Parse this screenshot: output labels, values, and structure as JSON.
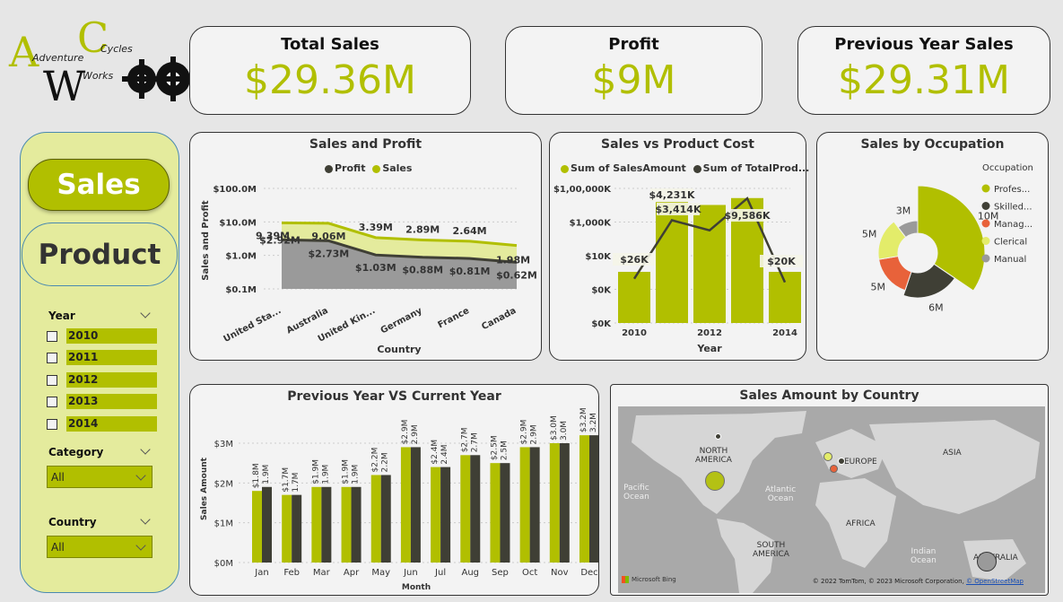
{
  "logo": {
    "line1": "Adventure",
    "line2": "Cycles",
    "line3": "Works"
  },
  "kpis": [
    {
      "title": "Total Sales",
      "value": "$29.36M"
    },
    {
      "title": "Profit",
      "value": "$9M"
    },
    {
      "title": "Previous Year Sales",
      "value": "$29.31M"
    }
  ],
  "nav": {
    "sales": "Sales",
    "product": "Product"
  },
  "filters": {
    "year_label": "Year",
    "years": [
      "2010",
      "2011",
      "2012",
      "2013",
      "2014"
    ],
    "category_label": "Category",
    "category_value": "All",
    "country_label": "Country",
    "country_value": "All"
  },
  "colors": {
    "accent": "#b1bf00",
    "dark": "#3f3f35",
    "orange": "#e8623a",
    "light": "#e3ec6a",
    "grey": "#9a9a9a"
  },
  "chart_data": [
    {
      "id": "sales_profit",
      "type": "area",
      "title": "Sales and Profit",
      "legend": [
        "Profit",
        "Sales"
      ],
      "categories": [
        "United Sta...",
        "Australia",
        "United Kin...",
        "Germany",
        "France",
        "Canada"
      ],
      "series": [
        {
          "name": "Sales",
          "values": [
            9.39,
            9.06,
            3.39,
            2.89,
            2.64,
            1.98
          ],
          "labels": [
            "9.39M",
            "9.06M",
            "3.39M",
            "2.89M",
            "2.64M",
            "1.98M"
          ]
        },
        {
          "name": "Profit",
          "values": [
            2.92,
            2.73,
            1.03,
            0.88,
            0.81,
            0.62
          ],
          "labels": [
            "$2.92M",
            "$2.73M",
            "$1.03M",
            "$0.88M",
            "$0.81M",
            "$0.62M"
          ]
        }
      ],
      "yticks": [
        "$100.0M",
        "$10.0M",
        "$1.0M",
        "$0.1M"
      ],
      "xlabel": "Country",
      "ylabel": "Sales and Profit",
      "yscale": "log"
    },
    {
      "id": "sales_cost",
      "type": "bar",
      "title": "Sales vs Product Cost",
      "legend": [
        "Sum of SalesAmount",
        "Sum of TotalProd..."
      ],
      "categories": [
        "2010",
        "2011",
        "2012",
        "2013",
        "2014"
      ],
      "xticks": [
        "2010",
        "2012",
        "2014"
      ],
      "series": [
        {
          "name": "Sum of SalesAmount",
          "values": [
            43,
            7300,
            5900,
            9800,
            43
          ]
        },
        {
          "name": "Sum of TotalProd...",
          "values": [
            26,
            4231,
            3414,
            9586,
            20
          ]
        }
      ],
      "labels": [
        "$26K",
        "$4,231K",
        "$3,414K",
        "$9,586K",
        "$20K"
      ],
      "yticks": [
        "$1,00,000K",
        "$1,000K",
        "$10K",
        "$0K",
        "$0K"
      ],
      "xlabel": "Year"
    },
    {
      "id": "occupation",
      "type": "pie",
      "title": "Sales by Occupation",
      "legend_title": "Occupation",
      "categories": [
        "Profes...",
        "Skilled...",
        "Manag...",
        "Clerical",
        "Manual"
      ],
      "values": [
        10,
        6,
        5,
        5,
        3
      ],
      "labels": [
        "10M",
        "6M",
        "5M",
        "5M",
        "3M"
      ]
    },
    {
      "id": "prev_vs_curr",
      "type": "bar",
      "title": "Previous Year VS Current Year",
      "categories": [
        "Jan",
        "Feb",
        "Mar",
        "Apr",
        "May",
        "Jun",
        "Jul",
        "Aug",
        "Sep",
        "Oct",
        "Nov",
        "Dec"
      ],
      "series": [
        {
          "name": "Previous Year",
          "values": [
            1.8,
            1.7,
            1.9,
            1.9,
            2.2,
            2.9,
            2.4,
            2.7,
            2.5,
            2.9,
            3.0,
            3.2
          ],
          "labels": [
            "$1.8M",
            "$1.7M",
            "$1.9M",
            "$1.9M",
            "$2.2M",
            "$2.9M",
            "$2.4M",
            "$2.7M",
            "$2.5M",
            "$2.9M",
            "$3.0M",
            "$3.2M"
          ]
        },
        {
          "name": "Current Year",
          "values": [
            1.9,
            1.7,
            1.9,
            1.9,
            2.2,
            2.9,
            2.4,
            2.7,
            2.5,
            2.9,
            3.0,
            3.2
          ],
          "labels": [
            "1.9M",
            "1.7M",
            "1.9M",
            "1.9M",
            "2.2M",
            "2.9M",
            "2.4M",
            "2.7M",
            "2.5M",
            "2.9M",
            "3.0M",
            "3.2M"
          ]
        }
      ],
      "yticks": [
        "$3M",
        "$2M",
        "$1M",
        "$0M"
      ],
      "ylim": [
        0,
        3.5
      ],
      "xlabel": "Month",
      "ylabel": "Sales Amount"
    }
  ],
  "map": {
    "title": "Sales Amount by Country",
    "labels": {
      "na": "NORTH\nAMERICA",
      "europe": "EUROPE",
      "asia": "ASIA",
      "africa": "AFRICA",
      "sa": "SOUTH\nAMERICA",
      "aus": "AUSTRALIA",
      "pacific": "Pacific\nOcean",
      "atlantic": "Atlantic\nOcean",
      "indian": "Indian\nOcean"
    },
    "brand": "Microsoft Bing",
    "attribution": "© 2022 TomTom, © 2023 Microsoft Corporation,",
    "attribution_link": "© OpenStreetMap"
  }
}
